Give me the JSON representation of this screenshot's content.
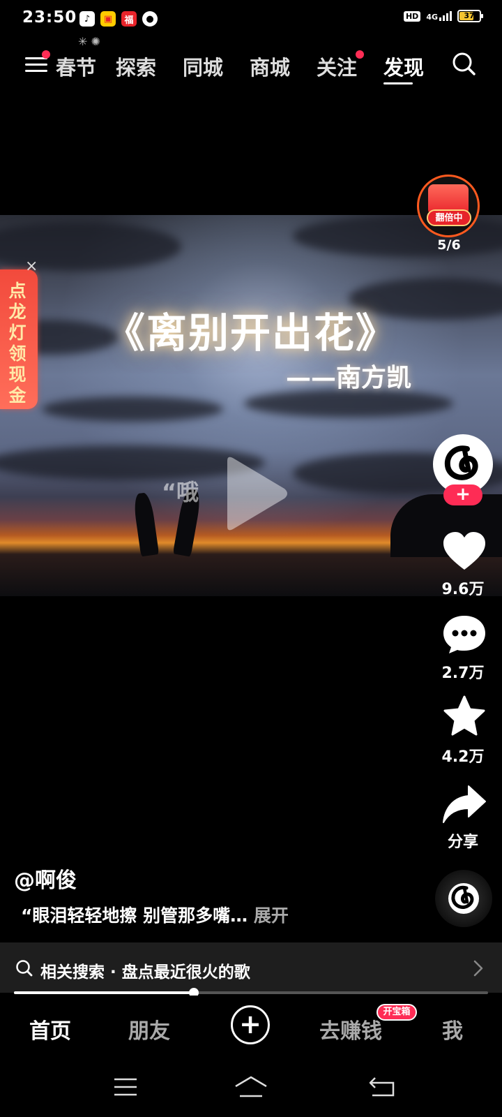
{
  "status_bar": {
    "time": "23:50",
    "app_icons": [
      "tiktok-icon",
      "kuaishou-icon",
      "red-icon",
      "cat-icon"
    ],
    "hd": "HD",
    "network": "4G",
    "battery": "37"
  },
  "top_nav": {
    "tabs": [
      {
        "label": "春节",
        "active": false
      },
      {
        "label": "探索",
        "active": false
      },
      {
        "label": "同城",
        "active": false
      },
      {
        "label": "商城",
        "active": false
      },
      {
        "label": "关注",
        "active": false
      },
      {
        "label": "发现",
        "active": true
      }
    ]
  },
  "video": {
    "title": "《离别开出花》",
    "artist": "——南方凯",
    "quote": "“哦",
    "state": "paused"
  },
  "promo": {
    "text": "点龙灯领现金"
  },
  "right_rail": {
    "redpack_badge": "翻倍中",
    "redpack_count": "5/6",
    "follow": "+",
    "likes": "9.6万",
    "comments": "2.7万",
    "favorites": "4.2万",
    "share": "分享"
  },
  "caption": {
    "author": "@啊俊",
    "text": "“眼泪轻轻地擦 别管那多嘴…",
    "expand": "展开"
  },
  "related_search": {
    "text": "相关搜索 · 盘点最近很火的歌"
  },
  "progress": {
    "fraction": 0.38
  },
  "bottom_nav": {
    "home": "首页",
    "friends": "朋友",
    "create": "+",
    "earn": "去赚钱",
    "earn_badge": "开宝箱",
    "me": "我"
  },
  "colors": {
    "accent": "#fe2c55",
    "background": "#000000"
  }
}
